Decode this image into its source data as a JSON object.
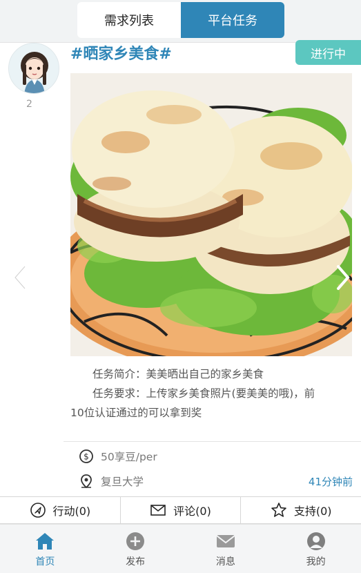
{
  "header": {
    "tabs": [
      {
        "label": "需求列表",
        "active": false
      },
      {
        "label": "平台任务",
        "active": true
      }
    ]
  },
  "user": {
    "avatar_icon": "girl-avatar",
    "count": "2"
  },
  "post": {
    "title": "#晒家乡美食#",
    "status": "进行中",
    "image": "roujiamo-sandwich-photo",
    "intro_label": "任务简介：",
    "intro_text": "美美晒出自己的家乡美食",
    "req_label": "任务要求：",
    "req_text_line1": "上传家乡美食照片(要美美的哦)，前",
    "req_text_line2": "10位认证通过的可以拿到奖",
    "reward": "50享豆/per",
    "location": "复旦大学",
    "time_ago": "41分钟前"
  },
  "actions": [
    {
      "label": "行动(0)",
      "icon": "navigation-arrow-icon"
    },
    {
      "label": "评论(0)",
      "icon": "mail-icon"
    },
    {
      "label": "支持(0)",
      "icon": "star-icon"
    }
  ],
  "tabbar": [
    {
      "label": "首页",
      "icon": "home-icon",
      "active": true
    },
    {
      "label": "发布",
      "icon": "plus-icon",
      "active": false
    },
    {
      "label": "消息",
      "icon": "message-icon",
      "active": false
    },
    {
      "label": "我的",
      "icon": "user-icon",
      "active": false
    }
  ],
  "colors": {
    "accent": "#2f86b7",
    "status": "#5cc7c0",
    "tabbar_bg": "#f4f5f6"
  }
}
